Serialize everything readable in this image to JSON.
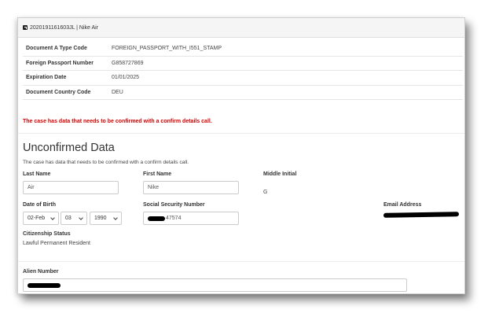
{
  "header": {
    "title": "2020191161603JL | Nike Air"
  },
  "document": {
    "rows": [
      {
        "label": "Document A Type Code",
        "value": "FOREIGN_PASSPORT_WITH_I551_STAMP"
      },
      {
        "label": "Foreign Passport Number",
        "value": "G858727869"
      },
      {
        "label": "Expiration Date",
        "value": "01/01/2025"
      },
      {
        "label": "Document Country Code",
        "value": "DEU"
      }
    ]
  },
  "warning": "The case has data that needs to be confirmed with a confirm details call.",
  "unconfirmed": {
    "title": "Unconfirmed Data",
    "subtitle": "The case has data that needs to be confirmed with a confirm details call.",
    "last_name": {
      "label": "Last Name",
      "value": "Air"
    },
    "first_name": {
      "label": "First Name",
      "value": "Nike"
    },
    "middle_initial": {
      "label": "Middle Initial",
      "value": "G"
    },
    "dob": {
      "label": "Date of Birth",
      "month": "02-Feb",
      "day": "03",
      "year": "1990"
    },
    "ssn": {
      "label": "Social Security Number",
      "visible_suffix": "47574"
    },
    "email": {
      "label": "Email Address"
    },
    "citizenship": {
      "label": "Citizenship Status",
      "value": "Lawful Permanent Resident"
    },
    "alien_number": {
      "label": "Alien Number"
    }
  },
  "colors": {
    "warning": "#d40000",
    "redaction": "#000000"
  }
}
